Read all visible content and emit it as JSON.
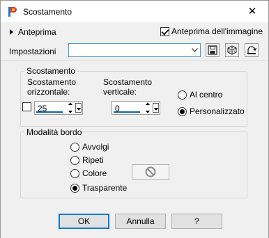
{
  "window": {
    "title": "Scostamento",
    "close_glyph": "✕"
  },
  "preview": {
    "expander_label": "Anteprima",
    "image_preview_label": "Anteprima dell'immagine",
    "image_preview_checked": true
  },
  "settings": {
    "label": "Impostazioni",
    "value": ""
  },
  "offset": {
    "title": "Scostamento",
    "horizontal_label_1": "Scostamento",
    "horizontal_label_2": "orizzontale:",
    "horizontal_value": "25",
    "vertical_label_1": "Scostamento",
    "vertical_label_2": "verticale:",
    "vertical_value": "0",
    "link_checked": false,
    "options": [
      {
        "label": "Al centro",
        "selected": false
      },
      {
        "label": "Personalizzato",
        "selected": true
      }
    ]
  },
  "edge_mode": {
    "title": "Modalità bordo",
    "options": [
      {
        "label": "Avvolgi",
        "selected": false
      },
      {
        "label": "Ripeti",
        "selected": false
      },
      {
        "label": "Colore",
        "selected": false
      },
      {
        "label": "Trasparente",
        "selected": true
      }
    ]
  },
  "buttons": {
    "ok": "OK",
    "cancel": "Annulla",
    "help": "?"
  },
  "colors": {
    "accent": "#0078d7",
    "spin_underline": "#0a64ad",
    "combo_border": "#4f9ad6"
  }
}
